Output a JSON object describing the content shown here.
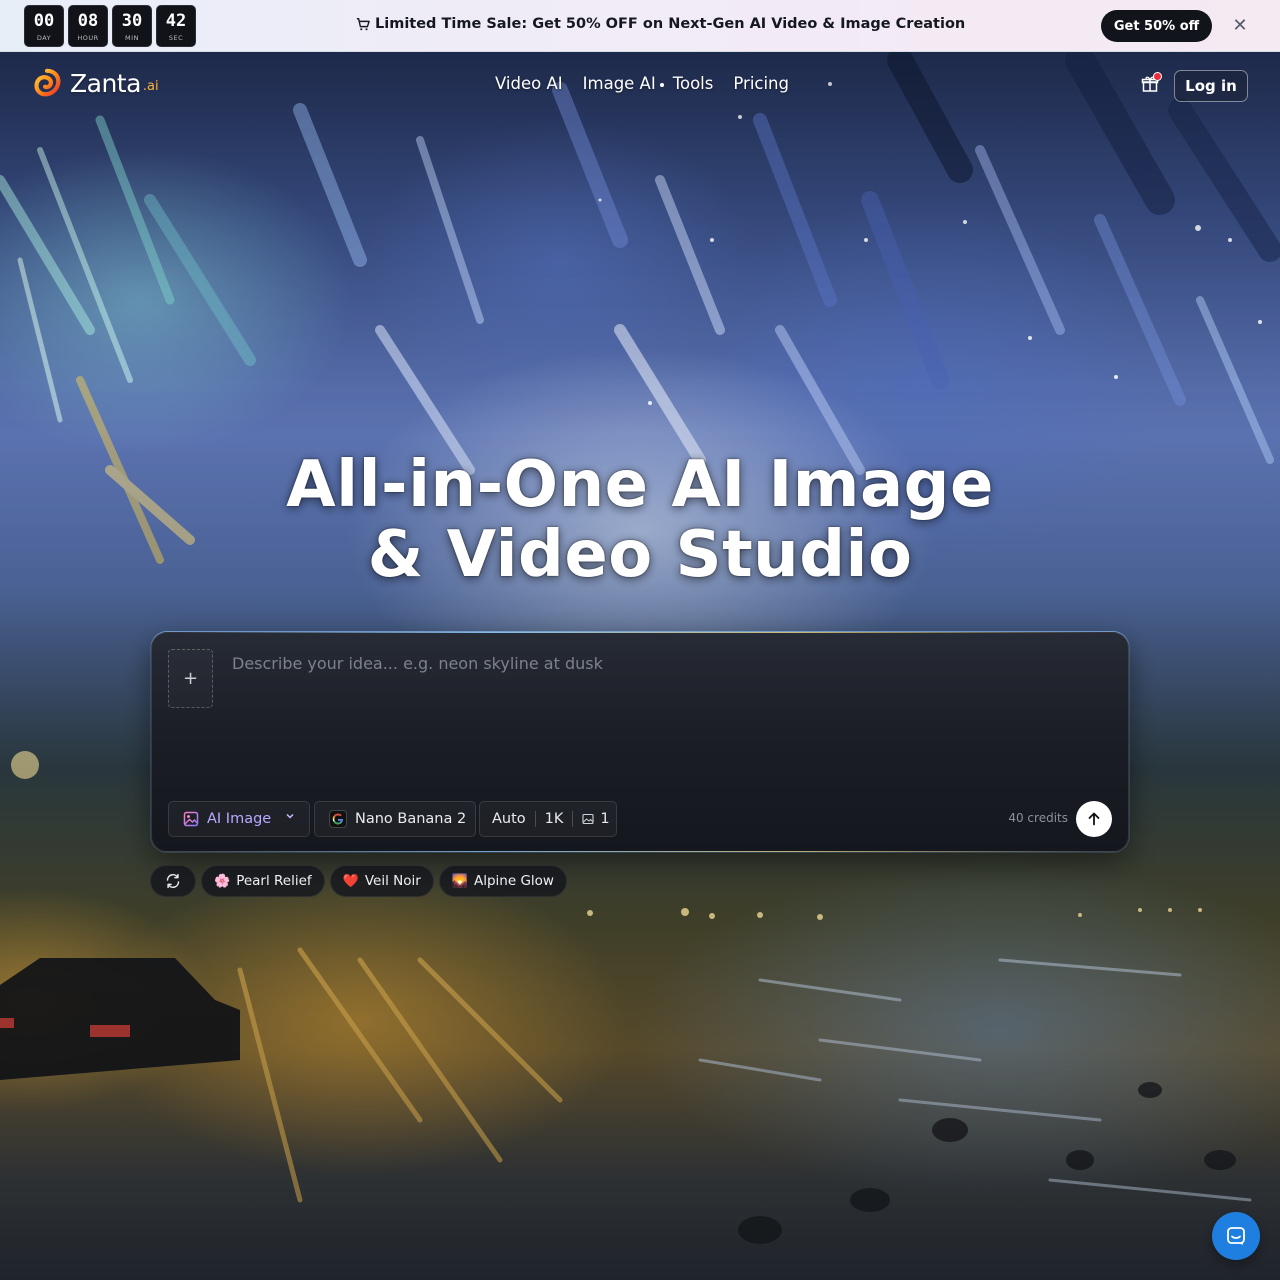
{
  "promo": {
    "timer": [
      {
        "value": "00",
        "unit": "DAY"
      },
      {
        "value": "08",
        "unit": "HOUR"
      },
      {
        "value": "30",
        "unit": "MIN"
      },
      {
        "value": "42",
        "unit": "SEC"
      }
    ],
    "message": "Limited Time Sale: Get 50% OFF on Next-Gen AI Video & Image Creation",
    "cta_label": "Get 50% off",
    "close_icon": "close-icon"
  },
  "nav": {
    "brand": "Zanta",
    "brand_suffix": ".ai",
    "links": [
      "Video AI",
      "Image AI",
      "Tools",
      "Pricing"
    ],
    "login_label": "Log in",
    "gift_icon": "gift-icon"
  },
  "hero": {
    "title_line1": "All-in-One AI Image",
    "title_line2": "& Video Studio"
  },
  "prompt": {
    "placeholder": "Describe your idea... e.g. neon skyline at dusk",
    "value": "",
    "mode_label": "AI Image",
    "model_label": "Nano Banana 2",
    "aspect": "Auto",
    "resolution": "1K",
    "count": "1",
    "credits": "40 credits"
  },
  "styles": [
    {
      "emoji": "🌸",
      "label": "Pearl Relief"
    },
    {
      "emoji": "❤️",
      "label": "Veil Noir"
    },
    {
      "emoji": "🌄",
      "label": "Alpine Glow"
    }
  ],
  "colors": {
    "accent_mode": "#b9a8ff",
    "logo_orange": "#ff8a1a",
    "chat_blue": "#1f7fe0",
    "badge_red": "#ef2b3c"
  }
}
